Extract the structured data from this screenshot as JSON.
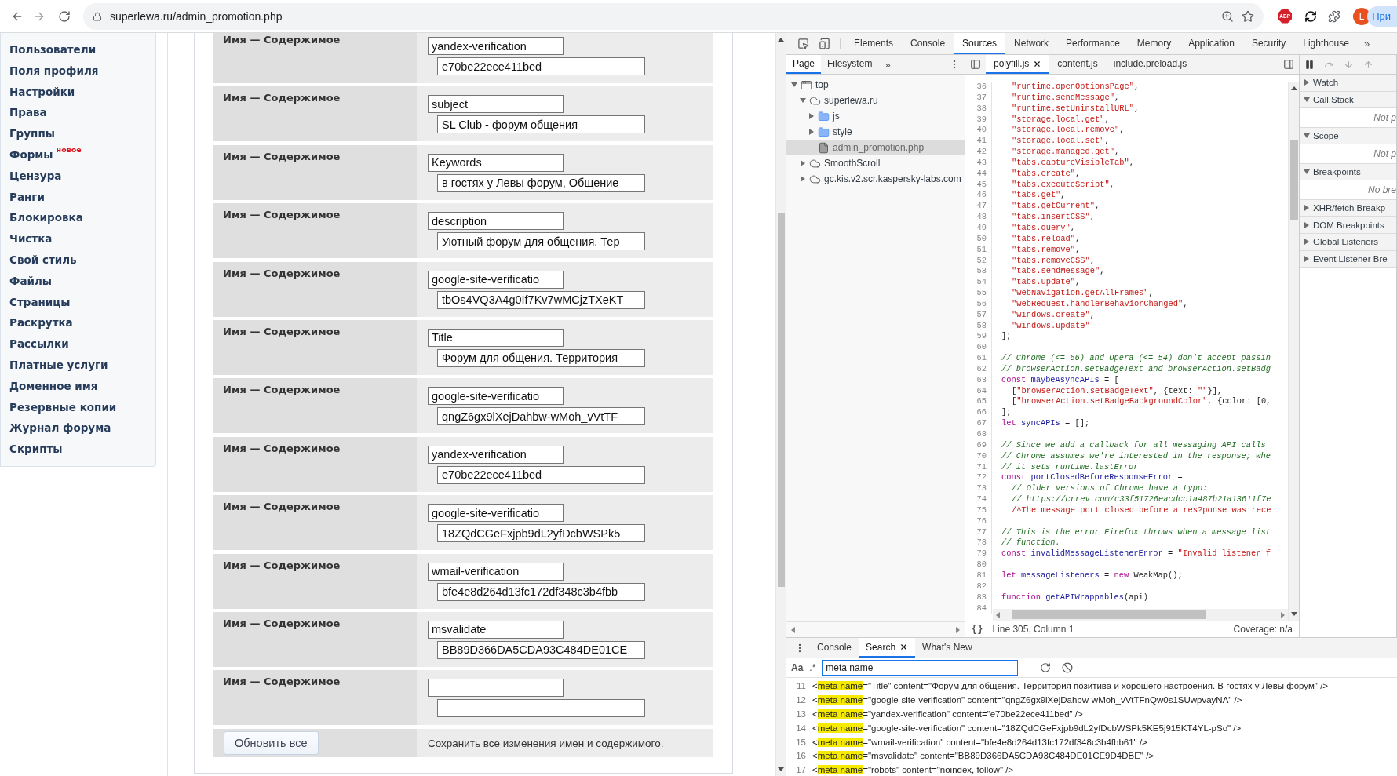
{
  "browser": {
    "url": "superlewa.ru/admin_promotion.php",
    "extension_badge": "ABP",
    "profile_initial": "L",
    "profile_label": "При"
  },
  "sidebar": {
    "items": [
      {
        "label": "Пользователи"
      },
      {
        "label": "Поля профиля"
      },
      {
        "label": "Настройки"
      },
      {
        "label": "Права"
      },
      {
        "label": "Группы"
      },
      {
        "label": "Формы",
        "badge": "новое"
      },
      {
        "label": "Цензура"
      },
      {
        "label": "Ранги"
      },
      {
        "label": "Блокировка"
      },
      {
        "label": "Чистка"
      },
      {
        "label": "Свой стиль"
      },
      {
        "label": "Файлы"
      },
      {
        "label": "Страницы"
      },
      {
        "label": "Раскрутка"
      },
      {
        "label": "Рассылки"
      },
      {
        "label": "Платные услуги"
      },
      {
        "label": "Доменное имя"
      },
      {
        "label": "Резервные копии"
      },
      {
        "label": "Журнал форума"
      },
      {
        "label": "Скрипты"
      }
    ]
  },
  "form": {
    "rows": [
      {
        "label": "Имя — Содержимое",
        "name": "yandex-verification",
        "content": "e70be22ece411bed"
      },
      {
        "label": "Имя — Содержимое",
        "name": "subject",
        "content": "SL Club - форум общения"
      },
      {
        "label": "Имя — Содержимое",
        "name": "Keywords",
        "content": "в гостях у Левы форум, Общение"
      },
      {
        "label": "Имя — Содержимое",
        "name": "description",
        "content": "Уютный форум для общения. Тер"
      },
      {
        "label": "Имя — Содержимое",
        "name": "google-site-verificatio",
        "content": "tbOs4VQ3A4g0If7Kv7wMCjzTXeKT"
      },
      {
        "label": "Имя — Содержимое",
        "name": "Title",
        "content": "Форум для общения. Территория"
      },
      {
        "label": "Имя — Содержимое",
        "name": "google-site-verificatio",
        "content": "qngZ6gx9lXejDahbw-wMoh_vVtTF"
      },
      {
        "label": "Имя — Содержимое",
        "name": "yandex-verification",
        "content": "e70be22ece411bed"
      },
      {
        "label": "Имя — Содержимое",
        "name": "google-site-verificatio",
        "content": "18ZQdCGeFxjpb9dL2yfDcbWSPk5"
      },
      {
        "label": "Имя — Содержимое",
        "name": "wmail-verification",
        "content": "bfe4e8d264d13fc172df348c3b4fbb"
      },
      {
        "label": "Имя — Содержимое",
        "name": "msvalidate",
        "content": "BB89D366DA5CDA93C484DE01CE"
      },
      {
        "label": "Имя — Содержимое"
      }
    ],
    "submit_button": "Обновить все",
    "submit_note": "Сохранить все изменения имен и содержимого."
  },
  "devtools": {
    "tabs": [
      {
        "label": "Elements",
        "selected": false
      },
      {
        "label": "Console",
        "selected": false
      },
      {
        "label": "Sources",
        "selected": true
      },
      {
        "label": "Network",
        "selected": false
      },
      {
        "label": "Performance",
        "selected": false
      },
      {
        "label": "Memory",
        "selected": false
      },
      {
        "label": "Application",
        "selected": false
      },
      {
        "label": "Security",
        "selected": false
      },
      {
        "label": "Lighthouse",
        "selected": false
      }
    ],
    "more": "»",
    "navigator": {
      "tabs": [
        {
          "label": "Page",
          "selected": true
        },
        {
          "label": "Filesystem",
          "selected": false
        }
      ],
      "more": "»",
      "tree": [
        {
          "label": "top",
          "kind": "frame",
          "expanded": true,
          "selected": false,
          "children": [
            {
              "label": "superlewa.ru",
              "kind": "domain",
              "expanded": true,
              "selected": false,
              "children": [
                {
                  "label": "js",
                  "kind": "folder",
                  "expanded": false,
                  "selected": false
                },
                {
                  "label": "style",
                  "kind": "folder",
                  "expanded": false,
                  "selected": false
                },
                {
                  "label": "admin_promotion.php",
                  "kind": "file",
                  "selected": true
                }
              ]
            },
            {
              "label": "SmoothScroll",
              "kind": "domain",
              "expanded": false,
              "selected": false
            },
            {
              "label": "gc.kis.v2.scr.kaspersky-labs.com",
              "kind": "domain",
              "expanded": false,
              "selected": false
            }
          ]
        }
      ]
    },
    "editor": {
      "tabs": [
        {
          "label": "polyfill.js",
          "selected": true,
          "closable": true
        },
        {
          "label": "content.js",
          "selected": false,
          "closable": false
        },
        {
          "label": "include.preload.js",
          "selected": false,
          "closable": false
        }
      ],
      "lines": [
        {
          "number": "36",
          "indented": true,
          "tokens": [
            {
              "kind": "string",
              "text": "\"runtime.openOptionsPage\""
            },
            {
              "kind": "plain",
              "text": ","
            }
          ]
        },
        {
          "number": "37",
          "indented": true,
          "tokens": [
            {
              "kind": "string",
              "text": "\"runtime.sendMessage\""
            },
            {
              "kind": "plain",
              "text": ","
            }
          ]
        },
        {
          "number": "38",
          "indented": true,
          "tokens": [
            {
              "kind": "string",
              "text": "\"runtime.setUninstallURL\""
            },
            {
              "kind": "plain",
              "text": ","
            }
          ]
        },
        {
          "number": "39",
          "indented": true,
          "tokens": [
            {
              "kind": "string",
              "text": "\"storage.local.get\""
            },
            {
              "kind": "plain",
              "text": ","
            }
          ]
        },
        {
          "number": "40",
          "indented": true,
          "tokens": [
            {
              "kind": "string",
              "text": "\"storage.local.remove\""
            },
            {
              "kind": "plain",
              "text": ","
            }
          ]
        },
        {
          "number": "41",
          "indented": true,
          "tokens": [
            {
              "kind": "string",
              "text": "\"storage.local.set\""
            },
            {
              "kind": "plain",
              "text": ","
            }
          ]
        },
        {
          "number": "42",
          "indented": true,
          "tokens": [
            {
              "kind": "string",
              "text": "\"storage.managed.get\""
            },
            {
              "kind": "plain",
              "text": ","
            }
          ]
        },
        {
          "number": "43",
          "indented": true,
          "tokens": [
            {
              "kind": "string",
              "text": "\"tabs.captureVisibleTab\""
            },
            {
              "kind": "plain",
              "text": ","
            }
          ]
        },
        {
          "number": "44",
          "indented": true,
          "tokens": [
            {
              "kind": "string",
              "text": "\"tabs.create\""
            },
            {
              "kind": "plain",
              "text": ","
            }
          ]
        },
        {
          "number": "45",
          "indented": true,
          "tokens": [
            {
              "kind": "string",
              "text": "\"tabs.executeScript\""
            },
            {
              "kind": "plain",
              "text": ","
            }
          ]
        },
        {
          "number": "46",
          "indented": true,
          "tokens": [
            {
              "kind": "string",
              "text": "\"tabs.get\""
            },
            {
              "kind": "plain",
              "text": ","
            }
          ]
        },
        {
          "number": "47",
          "indented": true,
          "tokens": [
            {
              "kind": "string",
              "text": "\"tabs.getCurrent\""
            },
            {
              "kind": "plain",
              "text": ","
            }
          ]
        },
        {
          "number": "48",
          "indented": true,
          "tokens": [
            {
              "kind": "string",
              "text": "\"tabs.insertCSS\""
            },
            {
              "kind": "plain",
              "text": ","
            }
          ]
        },
        {
          "number": "49",
          "indented": true,
          "tokens": [
            {
              "kind": "string",
              "text": "\"tabs.query\""
            },
            {
              "kind": "plain",
              "text": ","
            }
          ]
        },
        {
          "number": "50",
          "indented": true,
          "tokens": [
            {
              "kind": "string",
              "text": "\"tabs.reload\""
            },
            {
              "kind": "plain",
              "text": ","
            }
          ]
        },
        {
          "number": "51",
          "indented": true,
          "tokens": [
            {
              "kind": "string",
              "text": "\"tabs.remove\""
            },
            {
              "kind": "plain",
              "text": ","
            }
          ]
        },
        {
          "number": "52",
          "indented": true,
          "tokens": [
            {
              "kind": "string",
              "text": "\"tabs.removeCSS\""
            },
            {
              "kind": "plain",
              "text": ","
            }
          ]
        },
        {
          "number": "53",
          "indented": true,
          "tokens": [
            {
              "kind": "string",
              "text": "\"tabs.sendMessage\""
            },
            {
              "kind": "plain",
              "text": ","
            }
          ]
        },
        {
          "number": "54",
          "indented": true,
          "tokens": [
            {
              "kind": "string",
              "text": "\"tabs.update\""
            },
            {
              "kind": "plain",
              "text": ","
            }
          ]
        },
        {
          "number": "55",
          "indented": true,
          "tokens": [
            {
              "kind": "string",
              "text": "\"webNavigation.getAllFrames\""
            },
            {
              "kind": "plain",
              "text": ","
            }
          ]
        },
        {
          "number": "56",
          "indented": true,
          "tokens": [
            {
              "kind": "string",
              "text": "\"webRequest.handlerBehaviorChanged\""
            },
            {
              "kind": "plain",
              "text": ","
            }
          ]
        },
        {
          "number": "57",
          "indented": true,
          "tokens": [
            {
              "kind": "string",
              "text": "\"windows.create\""
            },
            {
              "kind": "plain",
              "text": ","
            }
          ]
        },
        {
          "number": "58",
          "indented": true,
          "tokens": [
            {
              "kind": "string",
              "text": "\"windows.update\""
            }
          ]
        },
        {
          "number": "59",
          "tokens": [
            {
              "kind": "plain",
              "text": "];"
            }
          ]
        },
        {
          "number": "60"
        },
        {
          "number": "61",
          "tokens": [
            {
              "kind": "comment",
              "text": "// Chrome (<= 66) and Opera (<= 54) don't accept passin"
            }
          ]
        },
        {
          "number": "62",
          "tokens": [
            {
              "kind": "comment",
              "text": "// browserAction.setBadgeText and browserAction.setBadg"
            }
          ]
        },
        {
          "number": "63",
          "tokens": [
            {
              "kind": "keyword",
              "text": "const "
            },
            {
              "kind": "name",
              "text": "maybeAsyncAPIs"
            },
            {
              "kind": "plain",
              "text": " = ["
            }
          ]
        },
        {
          "number": "64",
          "indented": true,
          "tokens": [
            {
              "kind": "plain",
              "text": "["
            },
            {
              "kind": "string",
              "text": "\"browserAction.setBadgeText\""
            },
            {
              "kind": "plain",
              "text": ", {text: "
            },
            {
              "kind": "string",
              "text": "\"\""
            },
            {
              "kind": "plain",
              "text": "}],"
            }
          ]
        },
        {
          "number": "65",
          "indented": true,
          "tokens": [
            {
              "kind": "plain",
              "text": "["
            },
            {
              "kind": "string",
              "text": "\"browserAction.setBadgeBackgroundColor\""
            },
            {
              "kind": "plain",
              "text": ", {color: [0,"
            }
          ]
        },
        {
          "number": "66",
          "tokens": [
            {
              "kind": "plain",
              "text": "];"
            }
          ]
        },
        {
          "number": "67",
          "tokens": [
            {
              "kind": "keyword",
              "text": "let "
            },
            {
              "kind": "name",
              "text": "syncAPIs"
            },
            {
              "kind": "plain",
              "text": " = [];"
            }
          ]
        },
        {
          "number": "68"
        },
        {
          "number": "69",
          "tokens": [
            {
              "kind": "comment",
              "text": "// Since we add a callback for all messaging API calls"
            }
          ]
        },
        {
          "number": "70",
          "tokens": [
            {
              "kind": "comment",
              "text": "// Chrome assumes we're interested in the response; whe"
            }
          ]
        },
        {
          "number": "71",
          "tokens": [
            {
              "kind": "comment",
              "text": "// it sets runtime.lastError"
            }
          ]
        },
        {
          "number": "72",
          "tokens": [
            {
              "kind": "keyword",
              "text": "const "
            },
            {
              "kind": "name",
              "text": "portClosedBeforeResponseError"
            },
            {
              "kind": "plain",
              "text": " ="
            }
          ]
        },
        {
          "number": "73",
          "indented": true,
          "tokens": [
            {
              "kind": "comment",
              "text": "// Older versions of Chrome have a typo:"
            }
          ]
        },
        {
          "number": "74",
          "indented": true,
          "tokens": [
            {
              "kind": "comment",
              "text": "// https://crrev.com/c33f51726eacdcc1a487b21a13611f7e"
            }
          ]
        },
        {
          "number": "75",
          "indented": true,
          "tokens": [
            {
              "kind": "string",
              "text": "/^The message port closed before a res?ponse was rece"
            }
          ]
        },
        {
          "number": "76"
        },
        {
          "number": "77",
          "tokens": [
            {
              "kind": "comment",
              "text": "// This is the error Firefox throws when a message list"
            }
          ]
        },
        {
          "number": "78",
          "tokens": [
            {
              "kind": "comment",
              "text": "// function."
            }
          ]
        },
        {
          "number": "79",
          "tokens": [
            {
              "kind": "keyword",
              "text": "const "
            },
            {
              "kind": "name",
              "text": "invalidMessageListenerError"
            },
            {
              "kind": "plain",
              "text": " = "
            },
            {
              "kind": "string",
              "text": "\"Invalid listener f"
            }
          ]
        },
        {
          "number": "80"
        },
        {
          "number": "81",
          "tokens": [
            {
              "kind": "keyword",
              "text": "let "
            },
            {
              "kind": "name",
              "text": "messageListeners"
            },
            {
              "kind": "plain",
              "text": " = "
            },
            {
              "kind": "keyword",
              "text": "new"
            },
            {
              "kind": "plain",
              "text": " WeakMap();"
            }
          ]
        },
        {
          "number": "82"
        },
        {
          "number": "83",
          "tokens": [
            {
              "kind": "keyword",
              "text": "function "
            },
            {
              "kind": "name",
              "text": "getAPIWrappables"
            },
            {
              "kind": "plain",
              "text": "(api)"
            }
          ]
        },
        {
          "number": "84"
        }
      ],
      "format_button": "{}",
      "position": "Line 305, Column 1",
      "coverage": "Coverage: n/a"
    },
    "debugger": {
      "sections": [
        {
          "title": "Watch",
          "expanded": false
        },
        {
          "title": "Call Stack",
          "expanded": true,
          "note": "Not p"
        },
        {
          "title": "Scope",
          "expanded": true,
          "note": "Not p"
        },
        {
          "title": "Breakpoints",
          "expanded": true,
          "note": "No bre"
        },
        {
          "title": "XHR/fetch Breakp",
          "expanded": false
        },
        {
          "title": "DOM Breakpoints",
          "expanded": false
        },
        {
          "title": "Global Listeners",
          "expanded": false
        },
        {
          "title": "Event Listener Bre",
          "expanded": false
        }
      ]
    },
    "drawer": {
      "tabs": [
        {
          "label": "Console",
          "selected": false,
          "closable": false
        },
        {
          "label": "Search",
          "selected": true,
          "closable": true
        },
        {
          "label": "What's New",
          "selected": false,
          "closable": false
        }
      ],
      "search": {
        "case_toggle": "Aa",
        "regex_toggle": ".*",
        "value": "meta name"
      },
      "results": [
        {
          "line": "11",
          "before": "<",
          "match": "meta name",
          "after": "=\"Title\" content=\"Форум для общения. Территория позитива и хорошего настроения. В гостях у Левы форум\" />"
        },
        {
          "line": "12",
          "before": "<",
          "match": "meta name",
          "after": "=\"google-site-verification\" content=\"qngZ6gx9lXejDahbw-wMoh_vVtTFnQw0s1SUwpvayNA\" />"
        },
        {
          "line": "13",
          "before": "<",
          "match": "meta name",
          "after": "=\"yandex-verification\" content=\"e70be22ece411bed\" />"
        },
        {
          "line": "14",
          "before": "<",
          "match": "meta name",
          "after": "=\"google-site-verification\" content=\"18ZQdCGeFxjpb9dL2yfDcbWSPk5KE5j915KT4YL-pSo\" />"
        },
        {
          "line": "15",
          "before": "<",
          "match": "meta name",
          "after": "=\"wmail-verification\" content=\"bfe4e8d264d13fc172df348c3b4fbb61\" />"
        },
        {
          "line": "16",
          "before": "<",
          "match": "meta name",
          "after": "=\"msvalidate\" content=\"BB89D366DA5CDA93C484DE01CE9D4DBE\" />"
        },
        {
          "line": "17",
          "before": "<",
          "match": "meta name",
          "after": "=\"robots\" content=\"noindex, follow\" />"
        }
      ]
    }
  }
}
